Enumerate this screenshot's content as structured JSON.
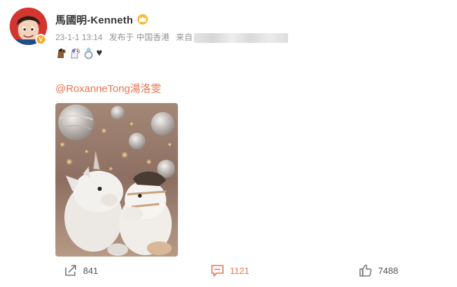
{
  "post": {
    "author": "馬國明-Kenneth",
    "avatar_icon": "avatar-cartoon-portrait",
    "badge_icon": "verified-badge-icon",
    "crown_icon": "crown-icon",
    "meta": {
      "time": "23-1-1 13:14",
      "published_in": "发布于 中国香港",
      "source_label": "来自"
    },
    "emojis": [
      "horse-emoji",
      "unicorn-emoji",
      "ring-emoji"
    ],
    "heart": "♥",
    "mention": "@RoxanneTong湯洛雯",
    "photo": {
      "description_icon": "plush-unicorn-and-horse-photo"
    }
  },
  "actions": {
    "share_count": "841",
    "comment_count": "1121",
    "like_count": "7488"
  },
  "colors": {
    "accent": "#eb7350",
    "meta_text": "#939393",
    "text": "#333333"
  }
}
